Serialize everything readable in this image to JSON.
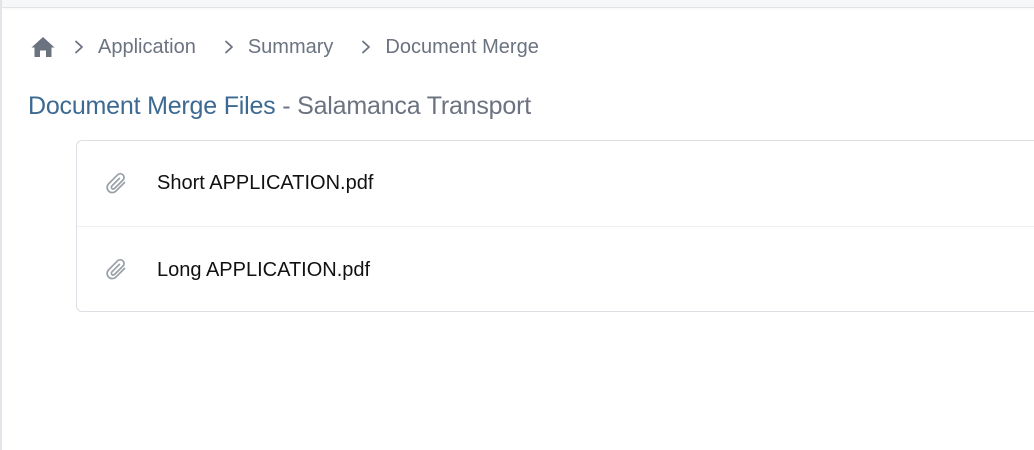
{
  "breadcrumb": {
    "home_icon": "home-icon",
    "separator_icon": "chevron-right-icon",
    "items": [
      {
        "label": "Application"
      },
      {
        "label": "Summary"
      },
      {
        "label": "Document Merge"
      }
    ]
  },
  "page": {
    "title": "Document Merge Files",
    "separator": "-",
    "subtitle": "Salamanca Transport"
  },
  "files": {
    "icon": "paperclip-icon",
    "items": [
      {
        "name": "Short APPLICATION.pdf"
      },
      {
        "name": "Long APPLICATION.pdf"
      }
    ]
  },
  "colors": {
    "title_accent": "#3d6a92",
    "muted_text": "#6b7280",
    "border": "#dcdfe3"
  }
}
